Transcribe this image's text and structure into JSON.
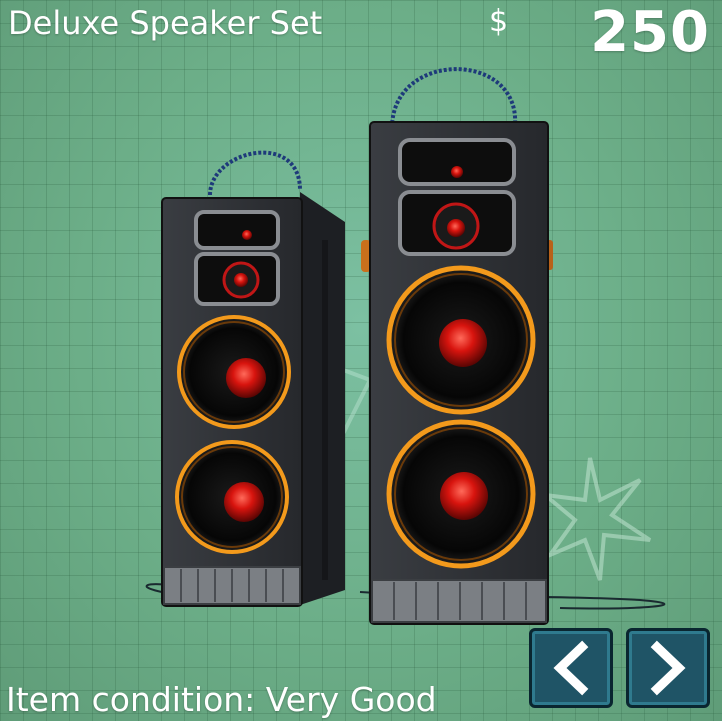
{
  "item": {
    "name": "Deluxe Speaker Set",
    "currency_symbol": "$",
    "price": "250",
    "condition_label": "Item condition: Very Good"
  },
  "controls": {
    "prev_icon": "chevron-left-icon",
    "next_icon": "chevron-right-icon"
  },
  "colors": {
    "background": "#6fae86",
    "button_fill": "#1f5466",
    "speaker_body": "#2b2e33",
    "speaker_ring": "#f39a1c",
    "speaker_cone": "#d8140e"
  }
}
